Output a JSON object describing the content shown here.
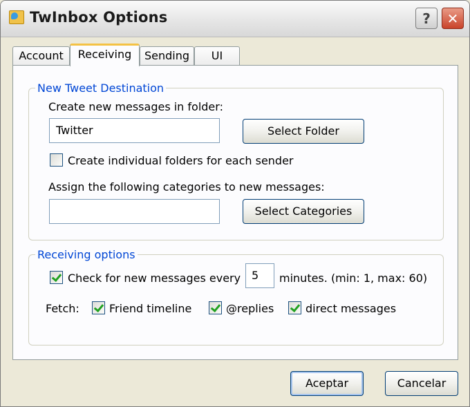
{
  "window": {
    "title": "TwInbox Options",
    "help_glyph": "?",
    "close_glyph": "✕"
  },
  "tabs": [
    {
      "label": "Account",
      "active": false
    },
    {
      "label": "Receiving",
      "active": true
    },
    {
      "label": "Sending",
      "active": false
    },
    {
      "label": "UI",
      "active": false
    }
  ],
  "destination": {
    "legend": "New Tweet Destination",
    "folder_prompt": "Create new messages in folder:",
    "folder_value": "Twitter",
    "select_folder_label": "Select Folder",
    "individual_folders_label": "Create individual folders for each sender",
    "individual_folders_checked": false,
    "categories_prompt": "Assign the following categories to new messages:",
    "categories_value": "",
    "select_categories_label": "Select Categories"
  },
  "receiving": {
    "legend": "Receiving options",
    "check_label": "Check for new messages every",
    "check_checked": true,
    "interval_value": "5",
    "interval_suffix": "minutes. (min: 1, max: 60)",
    "fetch_label": "Fetch:",
    "fetch_options": [
      {
        "label": "Friend timeline",
        "checked": true
      },
      {
        "label": "@replies",
        "checked": true
      },
      {
        "label": "direct messages",
        "checked": true
      }
    ]
  },
  "footer": {
    "ok_label": "Aceptar",
    "cancel_label": "Cancelar"
  },
  "colors": {
    "legend_text": "#0046d5",
    "active_tab_accent": "#f4c244",
    "close_button": "#c9432a"
  }
}
